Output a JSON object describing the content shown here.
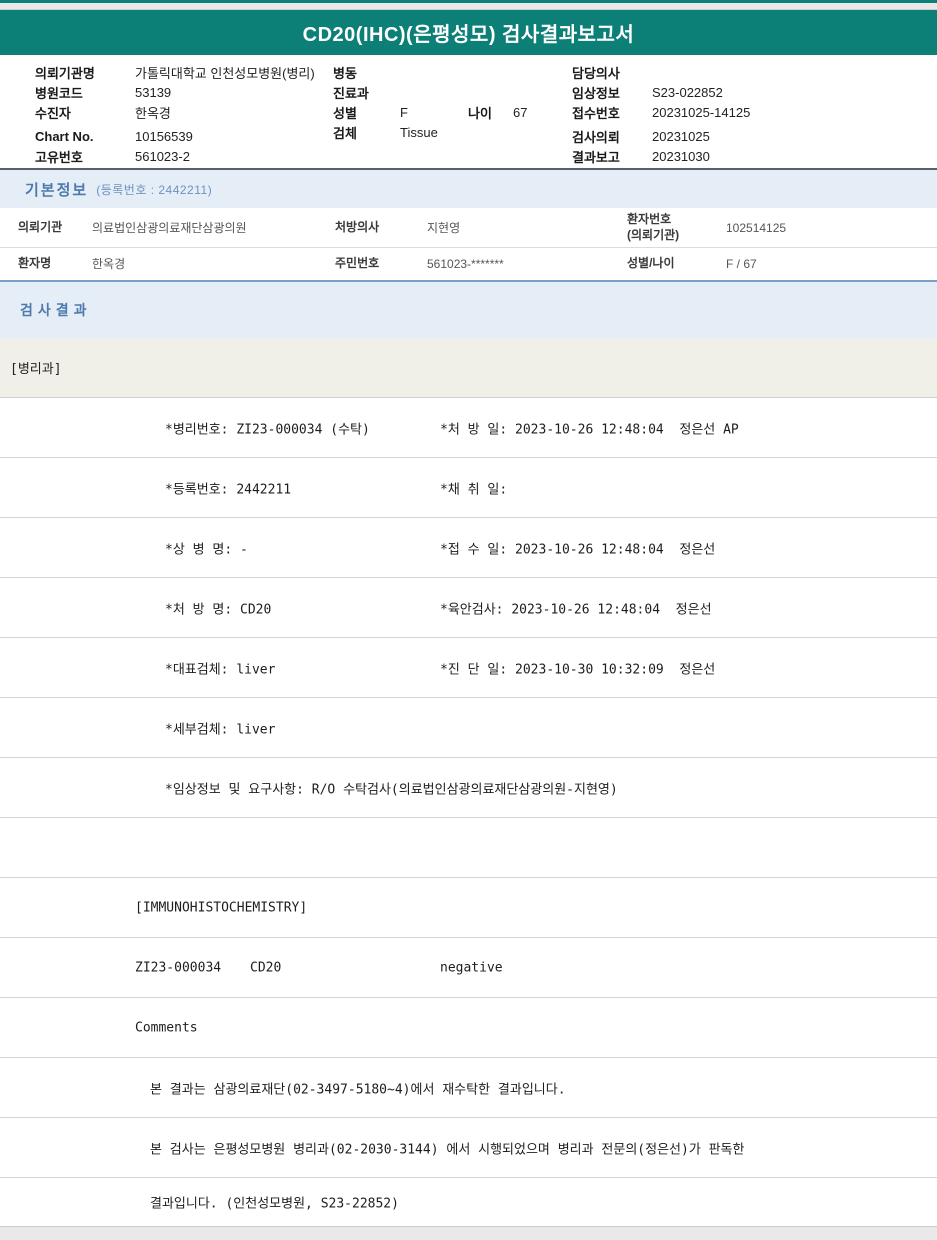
{
  "colors": {
    "banner_teal": "#0c7f77",
    "section_blue_bg": "#e5eef7",
    "section_blue_text": "#4e79ae",
    "steel_border": "#7ba0c4",
    "dept_row_bg": "#f0efe8"
  },
  "banner": {
    "title": "CD20(IHC)(은평성모) 검사결과보고서"
  },
  "patient_header": {
    "left": [
      {
        "label": "의뢰기관명",
        "value": "가톨릭대학교 인천성모병원(병리)"
      },
      {
        "label": "병원코드",
        "value": "53139"
      },
      {
        "label": "수진자",
        "value": "한옥경"
      },
      {
        "label": "Chart No.",
        "value": "10156539"
      },
      {
        "label": "고유번호",
        "value": "561023-2"
      }
    ],
    "middle": {
      "ward_label": "병동",
      "ward_value": "",
      "dept_label": "진료과",
      "dept_value": "",
      "sex_label": "성별",
      "sex_value": "F",
      "age_label": "나이",
      "age_value": "67",
      "specimen_label": "검체",
      "specimen_value": "Tissue"
    },
    "right": [
      {
        "label": "담당의사",
        "value": ""
      },
      {
        "label": "임상정보",
        "value": "S23-022852"
      },
      {
        "label": "접수번호",
        "value": "20231025-14125"
      },
      {
        "label": "검사의뢰",
        "value": "20231025"
      },
      {
        "label": "결과보고",
        "value": "20231030"
      }
    ]
  },
  "basic_info": {
    "title": "기본정보",
    "reg_no": "(등록번호 : 2442211)",
    "row1": {
      "c1_label": "의뢰기관",
      "c1_value": "의료법인삼광의료재단삼광의원",
      "c2_label": "처방의사",
      "c2_value": "지현영",
      "c3_label": "환자번호\n(의뢰기관)",
      "c3_value": "102514125"
    },
    "row2": {
      "c1_label": "환자명",
      "c1_value": "한옥경",
      "c2_label": "주민번호",
      "c2_value": "561023-*******",
      "c3_label": "성별/나이",
      "c3_value": "F / 67"
    }
  },
  "results": {
    "section_title": "검사결과",
    "department": "[병리과]",
    "rows": [
      {
        "left": "*병리번호: ZI23-000034 (수탁)",
        "right": "*처 방 일: 2023-10-26 12:48:04  정은선 AP"
      },
      {
        "left": "*등록번호: 2442211",
        "right": "*채 취 일:"
      },
      {
        "left": "*상 병 명: -",
        "right": "*접 수 일: 2023-10-26 12:48:04  정은선"
      },
      {
        "left": "*처 방 명: CD20",
        "right": "*육안검사: 2023-10-26 12:48:04  정은선"
      },
      {
        "left": "*대표검체: liver",
        "right": "*진 단 일: 2023-10-30 10:32:09  정은선"
      },
      {
        "left": "*세부검체: liver",
        "right": ""
      },
      {
        "left": "*임상정보 및 요구사항: R/O 수탁검사(의료법인삼광의료재단삼광의원-지현영)",
        "right": ""
      },
      {},
      {
        "text": "[IMMUNOHISTOCHEMISTRY]"
      },
      {
        "code": "ZI23-000034",
        "test": "CD20",
        "result": "negative"
      },
      {
        "text": "Comments"
      },
      {
        "text": "본 결과는 삼광의료재단(02-3497-5180~4)에서 재수탁한 결과입니다."
      },
      {
        "text": "본 검사는 은평성모병원 병리과(02-2030-3144) 에서 시행되었으며 병리과 전문의(정은선)가 판독한"
      },
      {
        "text": "결과입니다. (인천성모병원, S23-22852)"
      }
    ]
  }
}
